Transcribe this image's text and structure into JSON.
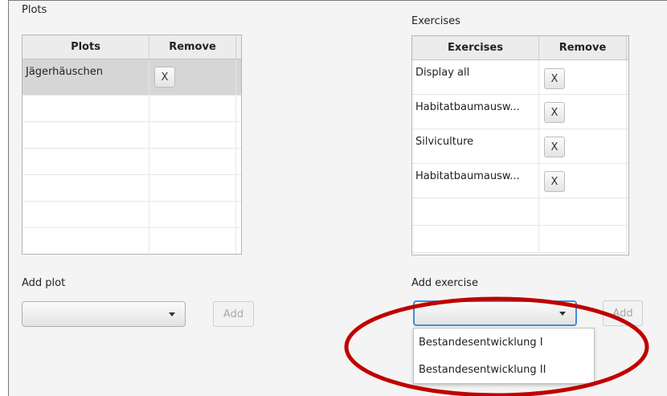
{
  "plots": {
    "section_label": "Plots",
    "columns": [
      "Plots",
      "Remove"
    ],
    "rows": [
      {
        "name": "Jägerhäuschen",
        "remove_label": "X"
      }
    ],
    "add_label": "Add plot",
    "add_button": "Add"
  },
  "exercises": {
    "section_label": "Exercises",
    "columns": [
      "Exercises",
      "Remove"
    ],
    "rows": [
      {
        "name": "Display all",
        "remove_label": "X"
      },
      {
        "name": "Habitatbaumausw...",
        "remove_label": "X"
      },
      {
        "name": "Silviculture",
        "remove_label": "X"
      },
      {
        "name": "Habitatbaumausw...",
        "remove_label": "X"
      }
    ],
    "add_label": "Add exercise",
    "add_button": "Add",
    "dropdown_options": [
      "Bestandesentwicklung I",
      "Bestandesentwicklung II"
    ]
  },
  "colors": {
    "highlight_ellipse": "#c00000",
    "combo_focus": "#3b8fd9",
    "selected_row": "#d6d6d6"
  }
}
